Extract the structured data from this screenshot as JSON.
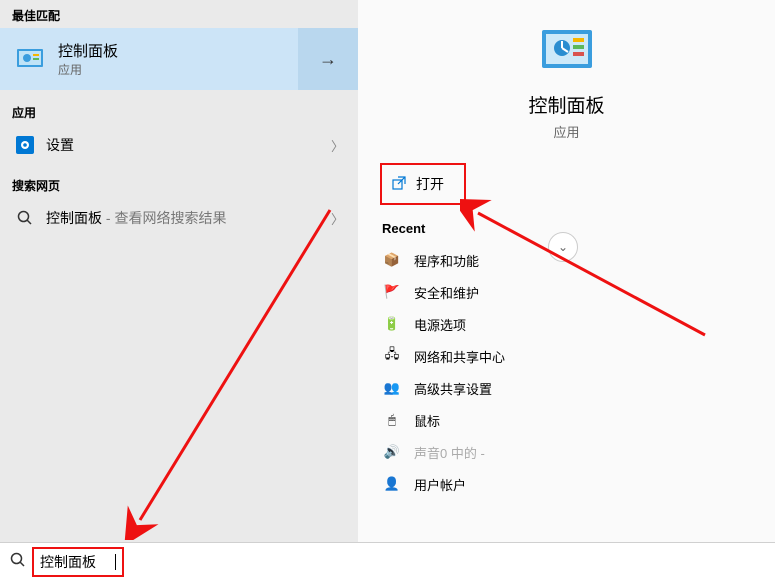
{
  "left": {
    "best_match_header": "最佳匹配",
    "best_title": "控制面板",
    "best_sub": "应用",
    "apps_header": "应用",
    "settings_label": "设置",
    "web_header": "搜索网页",
    "web_title": "控制面板",
    "web_sub": " - 查看网络搜索结果"
  },
  "right": {
    "hero_title": "控制面板",
    "hero_sub": "应用",
    "open_label": "打开",
    "recent_header": "Recent",
    "recent": [
      "程序和功能",
      "安全和维护",
      "电源选项",
      "网络和共享中心",
      "高级共享设置",
      "鼠标",
      "声音0 中的 -",
      "用户帐户"
    ]
  },
  "search": {
    "value": "控制面板"
  }
}
